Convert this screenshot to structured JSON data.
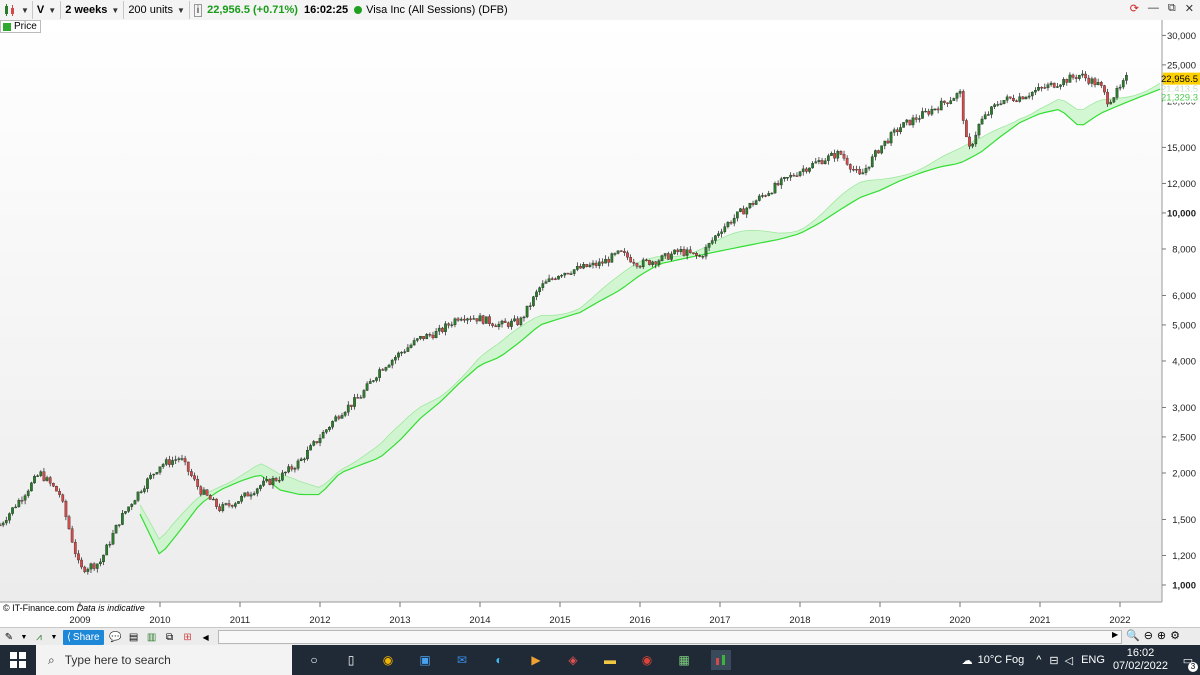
{
  "toolbar": {
    "symbol": "V",
    "interval": "2 weeks",
    "units": "200 units",
    "price": "22,956.5",
    "change": "(+0.71%)",
    "time": "16:02:25",
    "instrument": "Visa Inc (All Sessions) (DFB)",
    "legend_label": "Price",
    "colors": {
      "up": "#1a9c1a",
      "status": "#20a020"
    }
  },
  "chart": {
    "watermark": "© IT-Finance.com",
    "disclaimer": "Data is indicative",
    "price_tag": "22,956.5",
    "cloud_tag_1": "21,413.5",
    "cloud_tag_2": "21,329.3",
    "colors": {
      "up": "#2c7a2c",
      "down": "#d24a4a",
      "cloud_line": "#33dd33",
      "cloud_fill": "#c8f5c8",
      "cloud_fill_alt": "#c8e8f8",
      "price_tag": "#ffd000"
    }
  },
  "chart_data": {
    "type": "line",
    "y_scale": "log",
    "ylim": [
      900,
      33000
    ],
    "y_ticks": [
      {
        "label": "30,000",
        "value": 30000,
        "bold": false
      },
      {
        "label": "25,000",
        "value": 25000,
        "bold": false
      },
      {
        "label": "20,000",
        "value": 20000,
        "bold": false
      },
      {
        "label": "15,000",
        "value": 15000,
        "bold": false
      },
      {
        "label": "12,000",
        "value": 12000,
        "bold": false
      },
      {
        "label": "10,000",
        "value": 10000,
        "bold": true
      },
      {
        "label": "8,000",
        "value": 8000,
        "bold": false
      },
      {
        "label": "6,000",
        "value": 6000,
        "bold": false
      },
      {
        "label": "5,000",
        "value": 5000,
        "bold": false
      },
      {
        "label": "4,000",
        "value": 4000,
        "bold": false
      },
      {
        "label": "3,000",
        "value": 3000,
        "bold": false
      },
      {
        "label": "2,500",
        "value": 2500,
        "bold": false
      },
      {
        "label": "2,000",
        "value": 2000,
        "bold": false
      },
      {
        "label": "1,500",
        "value": 1500,
        "bold": false
      },
      {
        "label": "1,200",
        "value": 1200,
        "bold": false
      },
      {
        "label": "1,000",
        "value": 1000,
        "bold": true
      }
    ],
    "x_ticks": [
      "2009",
      "2010",
      "2011",
      "2012",
      "2013",
      "2014",
      "2015",
      "2016",
      "2017",
      "2018",
      "2019",
      "2020",
      "2021",
      "2022"
    ],
    "xlim": [
      2008.0,
      2022.5
    ],
    "series": [
      {
        "name": "Price",
        "x": [
          2008.0,
          2008.25,
          2008.5,
          2008.75,
          2009.0,
          2009.25,
          2009.5,
          2009.75,
          2010.0,
          2010.25,
          2010.5,
          2010.75,
          2011.0,
          2011.25,
          2011.5,
          2011.75,
          2012.0,
          2012.25,
          2012.5,
          2012.75,
          2013.0,
          2013.25,
          2013.5,
          2013.75,
          2014.0,
          2014.25,
          2014.5,
          2014.75,
          2015.0,
          2015.25,
          2015.5,
          2015.75,
          2016.0,
          2016.25,
          2016.5,
          2016.75,
          2017.0,
          2017.25,
          2017.5,
          2017.75,
          2018.0,
          2018.25,
          2018.5,
          2018.75,
          2019.0,
          2019.25,
          2019.5,
          2019.75,
          2020.0,
          2020.1,
          2020.25,
          2020.5,
          2020.75,
          2021.0,
          2021.25,
          2021.5,
          2021.75,
          2021.85,
          2022.0,
          2022.08
        ],
        "y": [
          1450,
          1700,
          2000,
          1750,
          1100,
          1150,
          1500,
          1800,
          2100,
          2200,
          1800,
          1600,
          1700,
          1850,
          1950,
          2150,
          2500,
          2900,
          3200,
          3800,
          4200,
          4600,
          4800,
          5300,
          5200,
          5000,
          5100,
          6300,
          6900,
          7100,
          7300,
          7800,
          7300,
          7500,
          7900,
          7600,
          9000,
          10000,
          11000,
          12000,
          13000,
          13800,
          14500,
          12500,
          15000,
          17000,
          18200,
          19500,
          21000,
          14500,
          17500,
          20000,
          20500,
          21500,
          22500,
          23500,
          22000,
          20000,
          21500,
          22956.5
        ]
      },
      {
        "name": "Cloud",
        "x": [
          2009.75,
          2010.0,
          2010.25,
          2010.5,
          2010.75,
          2011.0,
          2011.25,
          2011.5,
          2011.75,
          2012.0,
          2012.25,
          2012.5,
          2012.75,
          2013.0,
          2013.25,
          2013.5,
          2013.75,
          2014.0,
          2014.25,
          2014.5,
          2014.75,
          2015.0,
          2015.25,
          2015.5,
          2015.75,
          2016.0,
          2016.25,
          2016.5,
          2016.75,
          2017.0,
          2017.25,
          2017.5,
          2017.75,
          2018.0,
          2018.25,
          2018.5,
          2018.75,
          2019.0,
          2019.25,
          2019.5,
          2019.75,
          2020.0,
          2020.25,
          2020.5,
          2020.75,
          2021.0,
          2021.25,
          2021.5,
          2021.75,
          2022.0,
          2022.25,
          2022.5
        ],
        "y": [
          1550,
          1200,
          1400,
          1650,
          1800,
          1900,
          1980,
          1800,
          1750,
          1750,
          2000,
          2100,
          2200,
          2450,
          2800,
          3100,
          3500,
          3900,
          4100,
          4500,
          5000,
          5200,
          5400,
          5800,
          6200,
          6800,
          7300,
          7500,
          7700,
          7900,
          8100,
          8300,
          8500,
          8800,
          9400,
          10200,
          11000,
          11500,
          12200,
          12800,
          13300,
          13600,
          14500,
          16000,
          17500,
          18500,
          19000,
          17000,
          18500,
          19500,
          20500,
          21500
        ]
      }
    ]
  },
  "bottom_bar": {
    "share_label": "Share"
  },
  "taskbar": {
    "search_placeholder": "Type here to search",
    "weather": "10°C  Fog",
    "lang": "ENG",
    "time": "16:02",
    "date": "07/02/2022",
    "notifications": "3"
  }
}
